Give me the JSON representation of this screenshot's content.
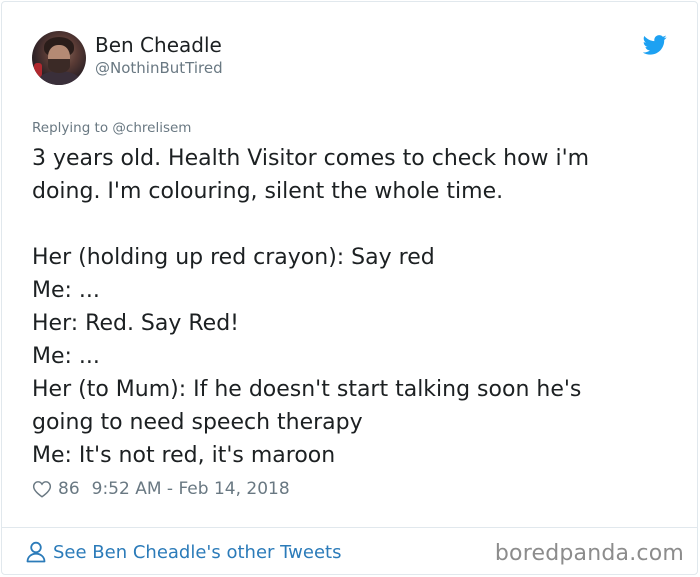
{
  "author": {
    "name": "Ben Cheadle",
    "handle": "@NothinButTired"
  },
  "icons": {
    "logo": "twitter-bird-icon",
    "like": "heart-icon",
    "profile": "person-icon",
    "avatar": "avatar"
  },
  "tweet": {
    "replying_to": "Replying to @chrelisem",
    "lines": [
      "3 years old. Health Visitor comes to check how i'm",
      "doing. I'm colouring, silent the whole time.",
      "",
      "Her (holding up red crayon): Say red",
      "Me: ...",
      "Her: Red. Say Red!",
      "Me: ...",
      "Her (to Mum): If he doesn't start talking soon he's",
      "going to need speech therapy",
      "Me: It's not red, it's maroon"
    ],
    "likes": "86",
    "timestamp": "9:52 AM - Feb 14, 2018"
  },
  "footer": {
    "see_more": "See Ben Cheadle's other Tweets"
  },
  "watermark": "boredpanda.com",
  "colors": {
    "twitter_blue": "#1da1f2",
    "link_blue": "#2b7bb9",
    "secondary_text": "#697882",
    "primary_text": "#1c2022",
    "border": "#e1e8ed"
  }
}
